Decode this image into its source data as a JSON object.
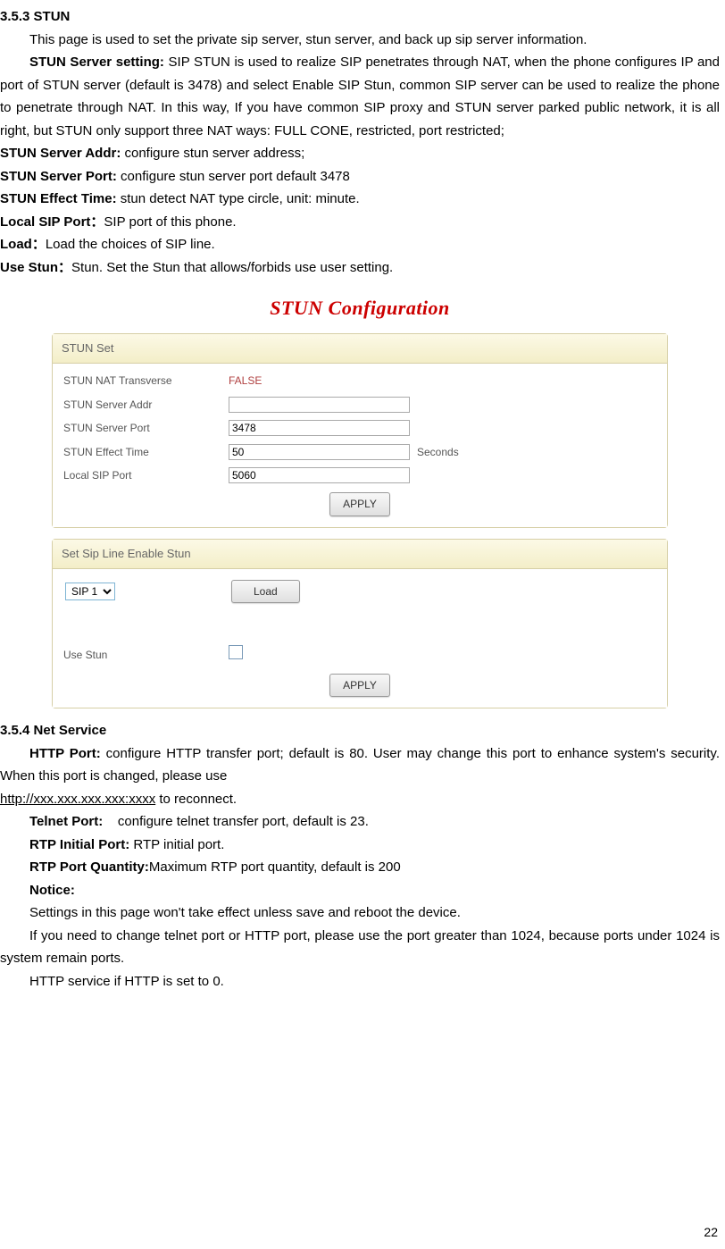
{
  "section_353_title": "3.5.3 STUN",
  "intro_para": "This page is used to set the private sip server, stun server, and back up sip server information.",
  "stun_server_setting_label": "STUN Server setting:",
  "stun_server_setting_text": " SIP STUN is used to realize SIP penetrates through NAT, when the phone configures IP and port of STUN server (default is 3478) and select Enable SIP Stun, common SIP server can be used to realize the phone to penetrate through NAT. In this way, If you have common SIP proxy and STUN server parked public network, it is all right, but STUN only support three NAT ways: FULL CONE, restricted, port restricted;",
  "addr_label": "STUN Server Addr:",
  "addr_text": " configure stun server address;",
  "port_label": "STUN Server Port:",
  "port_text": " configure stun server port default 3478",
  "effect_label": "STUN Effect Time:",
  "effect_text": " stun detect NAT type circle, unit: minute.",
  "local_sip_label": "Local SIP Port：",
  "local_sip_text": "SIP port of this phone.",
  "load_label": "Load：",
  "load_text": "Load the choices of SIP line.",
  "use_stun_label": "Use Stun：",
  "use_stun_text": "Stun. Set the Stun that allows/forbids use user setting.",
  "config_title": "STUN Configuration",
  "panel1": {
    "header": "STUN Set",
    "rows": {
      "nat_transverse_label": "STUN NAT Transverse",
      "nat_transverse_value": "FALSE",
      "server_addr_label": "STUN Server Addr",
      "server_addr_value": "",
      "server_port_label": "STUN Server Port",
      "server_port_value": "3478",
      "effect_time_label": "STUN Effect Time",
      "effect_time_value": "50",
      "effect_time_unit": "Seconds",
      "local_sip_label": "Local SIP Port",
      "local_sip_value": "5060"
    },
    "apply_label": "APPLY"
  },
  "panel2": {
    "header": "Set Sip Line Enable Stun",
    "sip_option": "SIP 1",
    "load_button": "Load",
    "use_stun_label": "Use Stun",
    "apply_label": "APPLY"
  },
  "section_354_title": "3.5.4 Net Service",
  "http_port_label": "HTTP Port:",
  "http_port_text": " configure HTTP transfer port; default is 80. User may change this port to enhance system's security. When this port is changed, please use ",
  "http_url": "http://xxx.xxx.xxx.xxx:xxxx",
  "http_port_text2": " to reconnect.",
  "telnet_label": "Telnet Port:",
  "telnet_text": "    configure telnet transfer port, default is 23.",
  "rtp_initial_label": "RTP Initial Port:",
  "rtp_initial_text": " RTP initial port.",
  "rtp_quantity_label": "RTP Port Quantity:",
  "rtp_quantity_text": "Maximum RTP port quantity, default is 200",
  "notice_label": "Notice:",
  "notice1": "Settings in this page won't take effect unless save and reboot the device.",
  "notice2": "If you need to change telnet port or HTTP port, please use the port greater than 1024, because ports under 1024 is system remain ports.",
  "notice3": "HTTP service if HTTP is set to 0.",
  "page_number": "22"
}
